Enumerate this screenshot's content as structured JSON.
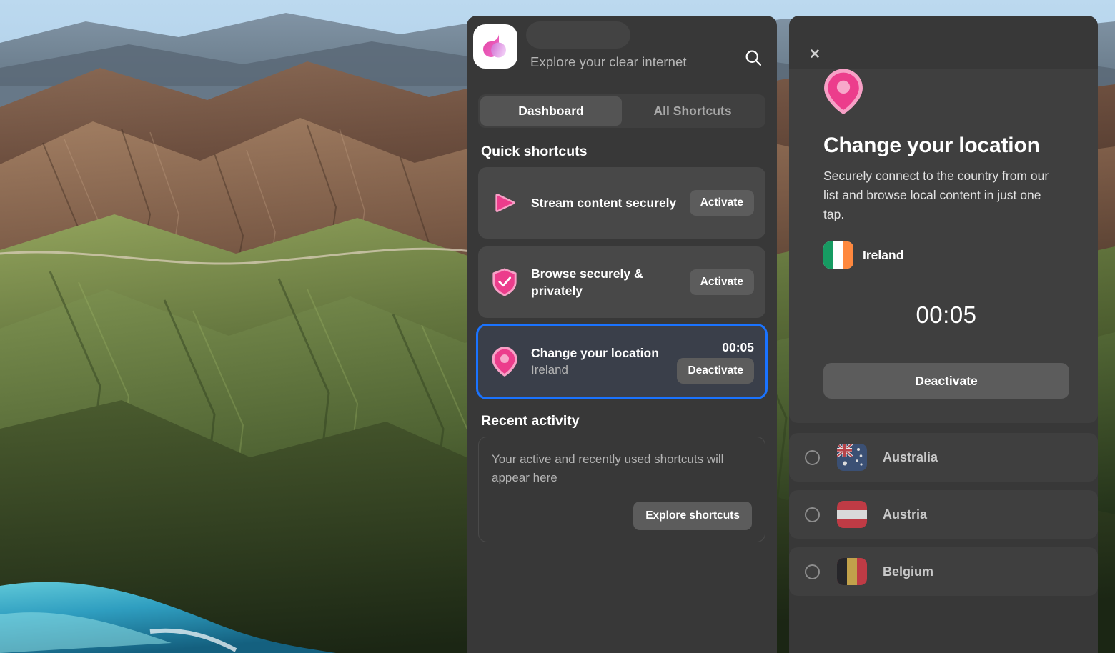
{
  "app": {
    "logo_icon": "app-droplet-logo",
    "tagline": "Explore your clear internet",
    "search_icon": "search-icon",
    "skeleton_placeholder": ""
  },
  "tabs": [
    {
      "label": "Dashboard",
      "active": true
    },
    {
      "label": "All Shortcuts",
      "active": false
    }
  ],
  "quick_shortcuts": {
    "heading": "Quick shortcuts",
    "items": [
      {
        "icon": "play-icon",
        "title": "Stream content securely",
        "subtitle": "",
        "timer": "",
        "button": "Activate",
        "active": false
      },
      {
        "icon": "shield-check-icon",
        "title": "Browse securely & privately",
        "subtitle": "",
        "timer": "",
        "button": "Activate",
        "active": false
      },
      {
        "icon": "location-pin-icon",
        "title": "Change your location",
        "subtitle": "Ireland",
        "timer": "00:05",
        "button": "Deactivate",
        "active": true
      }
    ]
  },
  "recent_activity": {
    "heading": "Recent activity",
    "empty_text": "Your active and recently used shortcuts will appear here",
    "cta_label": "Explore shortcuts"
  },
  "detail_panel": {
    "close_label": "✕",
    "icon": "location-pin-icon",
    "title": "Change your location",
    "description": "Securely connect to the country from our list and browse local content in just one tap.",
    "selected_country": "Ireland",
    "selected_country_flag": "flag-ireland",
    "timer": "00:05",
    "action_label": "Deactivate"
  },
  "country_list": [
    {
      "name": "Australia",
      "flag": "flag-australia",
      "selected": false
    },
    {
      "name": "Austria",
      "flag": "flag-austria",
      "selected": false
    },
    {
      "name": "Belgium",
      "flag": "flag-belgium",
      "selected": false
    }
  ],
  "colors": {
    "panel_bg": "#383838",
    "card_bg": "#484848",
    "button_bg": "#5c5c5c",
    "accent_pink": "#ec3d8c",
    "accent_pink_light": "#f58cb8",
    "focus_blue": "#1a73ff",
    "text_primary": "#ffffff",
    "text_muted": "#b4b4b4"
  }
}
